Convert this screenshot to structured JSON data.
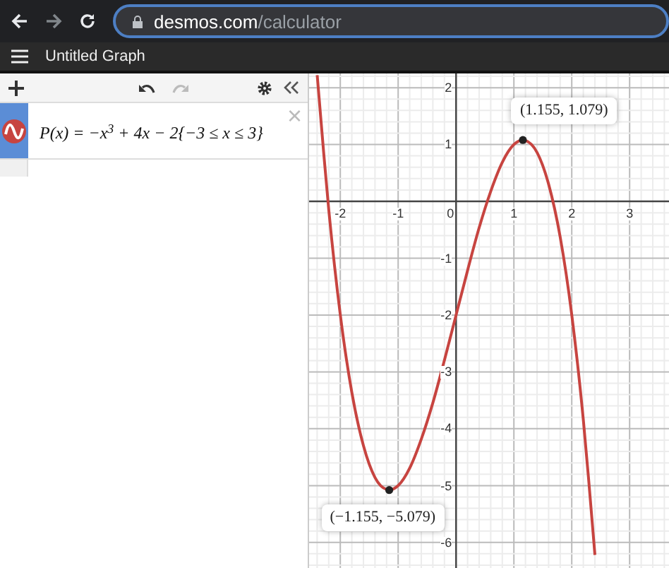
{
  "browser": {
    "url_host": "desmos.com",
    "url_path": "/calculator"
  },
  "header": {
    "title": "Untitled Graph"
  },
  "expressions": [
    {
      "latex": "P(x) = −x$^{3}$ + 4x − 2{−3 ≤ x ≤ 3}",
      "close": "×"
    }
  ],
  "graph": {
    "chart_data": {
      "type": "line",
      "grid": true,
      "xlim": [
        -2.54,
        3.68
      ],
      "ylim": [
        -6.45,
        2.25
      ],
      "xticks": [
        {
          "value": -2,
          "label": "-2"
        },
        {
          "value": -1,
          "label": "-1"
        },
        {
          "value": 0,
          "label": "0"
        },
        {
          "value": 1,
          "label": "1"
        },
        {
          "value": 2,
          "label": "2"
        },
        {
          "value": 3,
          "label": "3"
        }
      ],
      "yticks": [
        {
          "value": 2,
          "label": "2"
        },
        {
          "value": 1,
          "label": "1"
        },
        {
          "value": -1,
          "label": "-1"
        },
        {
          "value": -2,
          "label": "-2"
        },
        {
          "value": -3,
          "label": "-3"
        },
        {
          "value": -4,
          "label": "-4"
        },
        {
          "value": -5,
          "label": "-5"
        },
        {
          "value": -6,
          "label": "-6"
        }
      ],
      "x": [
        -2.4,
        -2.2,
        -2.0,
        -1.8,
        -1.6,
        -1.4,
        -1.2,
        -1.0,
        -0.8,
        -0.6,
        -0.4,
        -0.2,
        0,
        0.2,
        0.4,
        0.6,
        0.8,
        1.0,
        1.2,
        1.4,
        1.6,
        1.8,
        2.0,
        2.2,
        2.4
      ],
      "series": [
        {
          "color": "#c74440",
          "values": [
            2.22,
            -0.15,
            -2,
            -3.37,
            -4.3,
            -4.86,
            -5.07,
            -5,
            -4.69,
            -4.18,
            -3.54,
            -2.79,
            -2,
            -1.21,
            -0.46,
            0.18,
            0.69,
            1,
            1.07,
            0.86,
            0.3,
            -0.63,
            -2,
            -3.85,
            -6.22
          ]
        }
      ],
      "annotations": [
        {
          "x": 1.155,
          "y": 1.079,
          "text": "(1.155, 1.079)"
        },
        {
          "x": -1.155,
          "y": -5.079,
          "text": "(−1.155, −5.079)"
        }
      ]
    }
  }
}
